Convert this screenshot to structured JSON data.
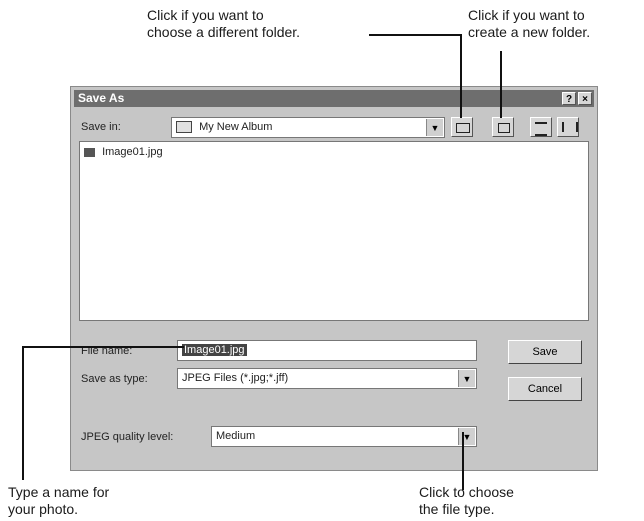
{
  "callouts": {
    "choose_folder": [
      "Click if you want to",
      "choose a different folder."
    ],
    "new_folder": [
      "Click if you want to",
      "create a new folder."
    ],
    "type_name": [
      "Type a name for",
      "your photo."
    ],
    "file_type": [
      "Click to choose",
      "the file type."
    ]
  },
  "dialog": {
    "title": "Save As",
    "help_glyph": "?",
    "close_glyph": "×",
    "save_in_label": "Save in:",
    "save_in_value": "My New Album",
    "files": [
      "Image01.jpg"
    ],
    "file_name_label": "File name:",
    "file_name_value": "Image01.jpg",
    "save_as_type_label": "Save as type:",
    "save_as_type_value": "JPEG Files (*.jpg;*.jff)",
    "jpeg_quality_label": "JPEG quality level:",
    "jpeg_quality_value": "Medium",
    "save_button": "Save",
    "cancel_button": "Cancel"
  }
}
